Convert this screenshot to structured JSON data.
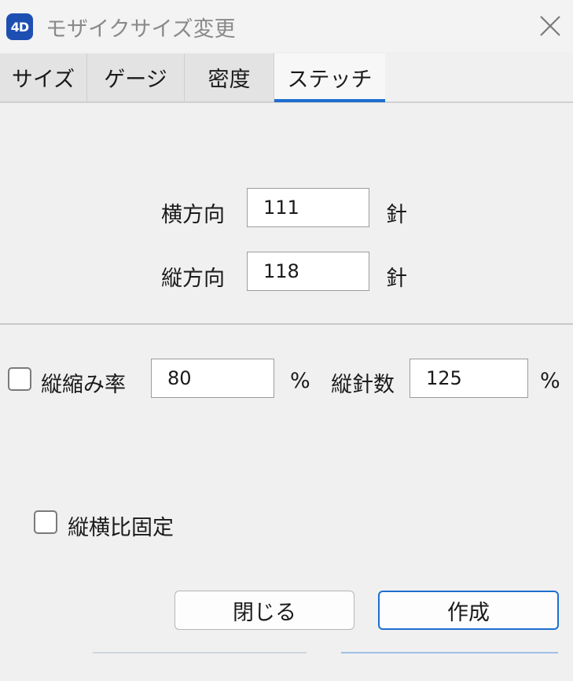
{
  "window": {
    "app_icon_text": "4D",
    "title": "モザイクサイズ変更"
  },
  "tabs": [
    {
      "label": "サイズ",
      "active": false
    },
    {
      "label": "ゲージ",
      "active": false
    },
    {
      "label": "密度",
      "active": false
    },
    {
      "label": "ステッチ",
      "active": true
    }
  ],
  "stitch": {
    "horizontal_label": "横方向",
    "horizontal_value": "111",
    "horizontal_unit": "針",
    "vertical_label": "縦方向",
    "vertical_value": "118",
    "vertical_unit": "針"
  },
  "ratio": {
    "shrink_checked": false,
    "shrink_label": "縦縮み率",
    "shrink_value": "80",
    "shrink_unit": "%",
    "needle_label": "縦針数",
    "needle_value": "125",
    "needle_unit": "%"
  },
  "aspect": {
    "checked": false,
    "label": "縦横比固定"
  },
  "buttons": {
    "close_label": "閉じる",
    "create_label": "作成"
  },
  "colors": {
    "accent": "#1e6fd0",
    "app_icon": "#1d4fb3",
    "background": "#f0f0f0"
  }
}
